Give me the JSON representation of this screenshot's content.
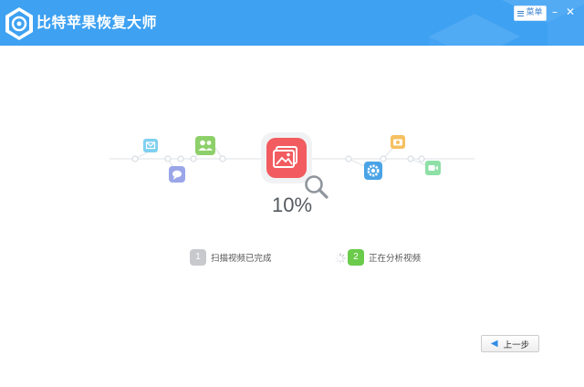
{
  "app": {
    "title": "比特苹果恢复大师"
  },
  "header": {
    "menu_label": "菜单",
    "minimize_glyph": "–",
    "close_glyph": "✕"
  },
  "progress": {
    "percent_text": "10%",
    "value": 0.1
  },
  "steps": [
    {
      "number": "1",
      "label": "扫描视频已完成",
      "state": "done",
      "color": "#c7c9cc"
    },
    {
      "number": "2",
      "label": "正在分析视频",
      "state": "active",
      "color": "#6bcb4b"
    }
  ],
  "footer": {
    "back_label": "上一步"
  },
  "colors": {
    "header_bg": "#3ea1f2",
    "center_icon": "#f25b5f",
    "mail_icon": "#7fd0f0",
    "contacts_icon": "#8dd06a",
    "message_icon": "#9aa6e8",
    "settings_icon": "#4aa3e6",
    "camera_icon": "#f6c061",
    "video_icon": "#8fe0a6"
  },
  "icons": [
    "app-logo-icon",
    "mail-icon",
    "contacts-icon",
    "message-icon",
    "photo-icon",
    "magnifier-icon",
    "settings-icon",
    "camera-icon",
    "video-icon"
  ]
}
